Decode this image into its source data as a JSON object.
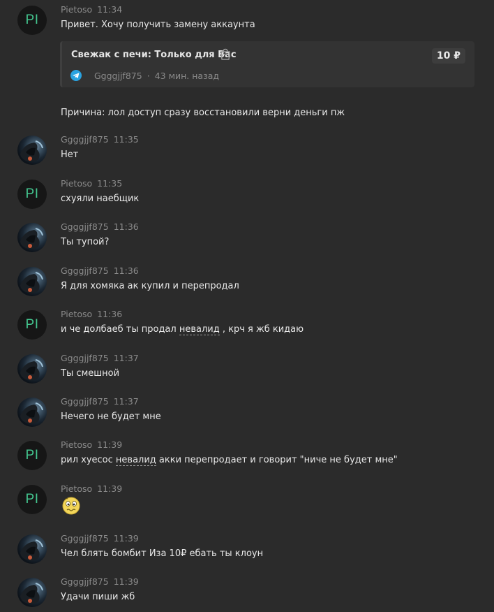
{
  "order_card": {
    "title": "Свежак с печи: Только для Вас",
    "buyer": "Ggggjjf875",
    "separator": "·",
    "time_ago": "43 мин. назад",
    "price": "10 ₽"
  },
  "reason_text": "Причина: лол доступ сразу восстановили верни деньги пж",
  "messages": [
    {
      "author": "Pietoso",
      "time": "11:34",
      "text": "Привет. Хочу получить замену аккаунта",
      "avatar_initials": "PI"
    },
    {
      "author": "Ggggjjf875",
      "time": "11:35",
      "text": "Нет"
    },
    {
      "author": "Pietoso",
      "time": "11:35",
      "text": "схуяли наебщик",
      "avatar_initials": "PI"
    },
    {
      "author": "Ggggjjf875",
      "time": "11:36",
      "text": "Ты тупой?"
    },
    {
      "author": "Ggggjjf875",
      "time": "11:36",
      "text": "Я для хомяка ак купил и перепродал"
    },
    {
      "author": "Pietoso",
      "time": "11:36",
      "text_before": "и че долбаеб ты продал ",
      "text_link": "невалид",
      "text_after": " , крч я жб кидаю",
      "avatar_initials": "PI"
    },
    {
      "author": "Ggggjjf875",
      "time": "11:37",
      "text": "Ты смешной"
    },
    {
      "author": "Ggggjjf875",
      "time": "11:37",
      "text": "Нечего не будет мне"
    },
    {
      "author": "Pietoso",
      "time": "11:39",
      "text_before": "рил хуесос ",
      "text_link": "невалид",
      "text_after": " акки перепродает и говорит \"ниче не будет мне\"",
      "avatar_initials": "PI"
    },
    {
      "author": "Pietoso",
      "time": "11:39",
      "emoji": "worried-face-emoji",
      "avatar_initials": "PI"
    },
    {
      "author": "Ggggjjf875",
      "time": "11:39",
      "text": "Чел блять бомбит Иза 10₽ ебать ты клоун"
    },
    {
      "author": "Ggggjjf875",
      "time": "11:39",
      "text": "Удачи пиши жб"
    }
  ],
  "colors": {
    "background": "#2b2b2b",
    "initials_accent": "#44c790",
    "meta_text": "#8a8a8a",
    "telegram_blue": "#2aa3e0"
  }
}
